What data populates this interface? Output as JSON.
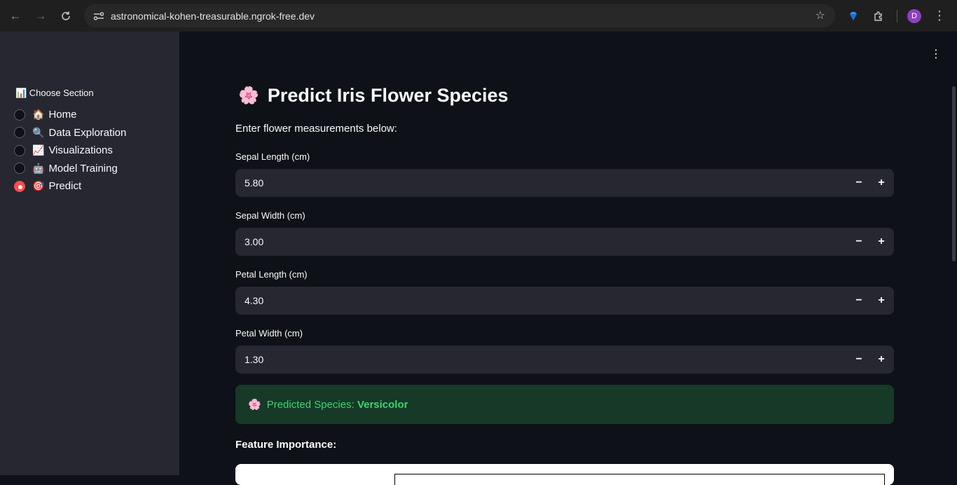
{
  "browser": {
    "url": "astronomical-kohen-treasurable.ngrok-free.dev",
    "profile_initial": "D"
  },
  "sidebar": {
    "label": "📊 Choose Section",
    "items": [
      {
        "emoji": "🏠",
        "label": "Home",
        "checked": false
      },
      {
        "emoji": "🔍",
        "label": "Data Exploration",
        "checked": false
      },
      {
        "emoji": "📈",
        "label": "Visualizations",
        "checked": false
      },
      {
        "emoji": "🤖",
        "label": "Model Training",
        "checked": false
      },
      {
        "emoji": "🎯",
        "label": "Predict",
        "checked": true
      }
    ]
  },
  "main": {
    "title_emoji": "🌸",
    "title": "Predict Iris Flower Species",
    "subtitle": "Enter flower measurements below:",
    "fields": [
      {
        "label": "Sepal Length (cm)",
        "value": "5.80"
      },
      {
        "label": "Sepal Width (cm)",
        "value": "3.00"
      },
      {
        "label": "Petal Length (cm)",
        "value": "4.30"
      },
      {
        "label": "Petal Width (cm)",
        "value": "1.30"
      }
    ],
    "stepper_minus": "−",
    "stepper_plus": "+",
    "prediction": {
      "emoji": "🌸",
      "prefix": "Predicted Species: ",
      "species": "Versicolor"
    },
    "feature_importance_heading": "Feature Importance:"
  },
  "colors": {
    "accent": "#ff4b4b",
    "success_bg": "#173928",
    "success_text": "#3dd56d"
  }
}
